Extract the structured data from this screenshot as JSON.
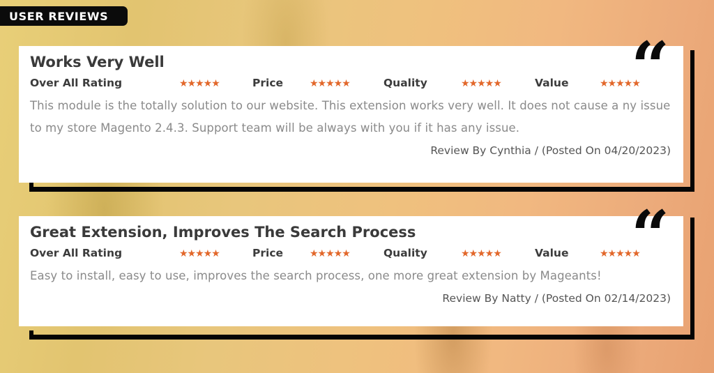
{
  "header": {
    "badge_label": "USER REVIEWS"
  },
  "rating_labels": {
    "overall": "Over All Rating",
    "price": "Price",
    "quality": "Quality",
    "value": "Value"
  },
  "icons": {
    "quote": "quote-icon",
    "star": "star-icon",
    "quote_glyph": "“",
    "stars_glyph": "★★★★★"
  },
  "colors": {
    "star": "#e2672a",
    "frame": "#050505",
    "badge": "#0b0b0b"
  },
  "reviews": [
    {
      "title": "Works Very Well",
      "ratings": {
        "overall": 5,
        "price": 5,
        "quality": 5,
        "value": 5,
        "max": 5
      },
      "body": "This module is the totally solution to our website. This extension works very well. It does not cause a ny issue to my store Magento 2.4.3. Support team will be always with you if it has any issue.",
      "byline": "Review By Cynthia / (Posted On 04/20/2023)"
    },
    {
      "title": "Great Extension, Improves The Search Process",
      "ratings": {
        "overall": 5,
        "price": 5,
        "quality": 5,
        "value": 5,
        "max": 5
      },
      "body": "Easy to install, easy to use, improves the search process, one more great extension by Mageants!",
      "byline": "Review By Natty / (Posted On 02/14/2023)"
    }
  ]
}
